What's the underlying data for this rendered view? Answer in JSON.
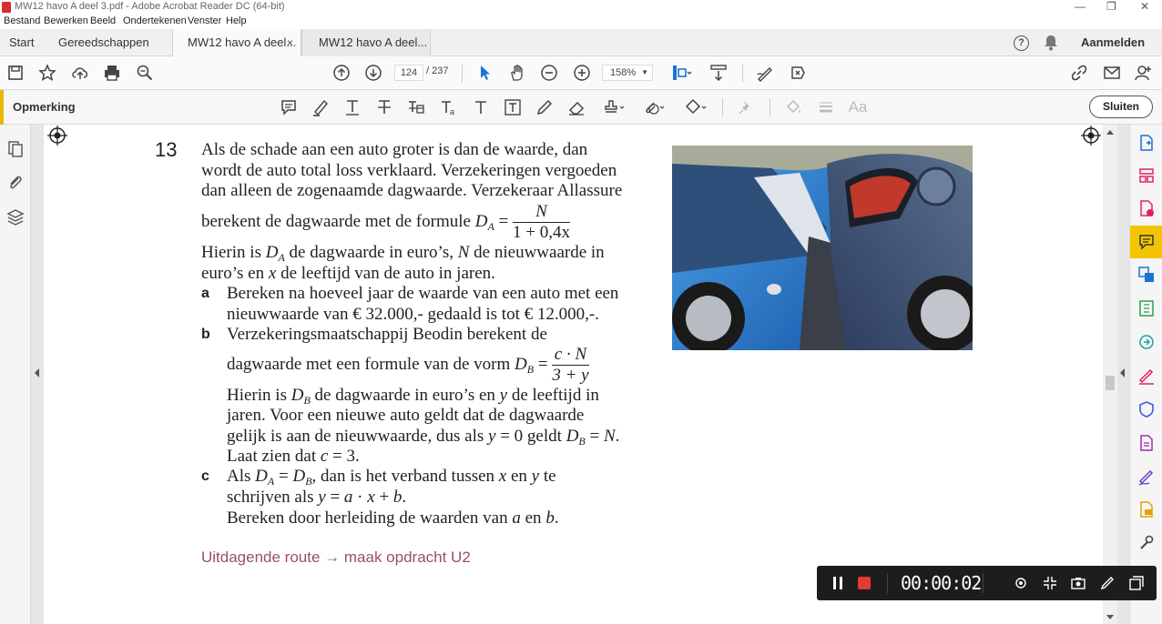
{
  "window": {
    "title": "MW12 havo A deel 3.pdf - Adobe Acrobat Reader DC (64-bit)",
    "minimize": "—",
    "maximize": "❐",
    "close": "✕"
  },
  "menu": [
    "Bestand",
    "Bewerken",
    "Beeld",
    "Ondertekenen",
    "Venster",
    "Help"
  ],
  "tabs": {
    "start": "Start",
    "tools": "Gereedschappen",
    "doc1": "MW12 havo A deel...",
    "doc2": "MW12 havo A deel...",
    "close_glyph": "×",
    "signin": "Aanmelden",
    "help_glyph": "?"
  },
  "toolbar": {
    "current_page": "124",
    "total_pages": "/ 237",
    "zoom": "158%"
  },
  "commentbar": {
    "label": "Opmerking",
    "close_label": "Sluiten"
  },
  "question": {
    "number": "13",
    "intro_lines": [
      "Als de schade aan een auto groter is dan de waarde, dan",
      "wordt de auto total loss verklaard. Verzekeringen vergoeden",
      "dan alleen de zogenaamde dagwaarde. Verzekeraar Allassure"
    ],
    "formula_line": "berekent de dagwaarde met de formule",
    "formula_a_num": "N",
    "formula_a_den": "1 + 0,4x",
    "def_line1_pre": "Hierin is",
    "def_line1_post": "de dagwaarde in euro’s,",
    "def_line1_end": "de nieuwwaarde in",
    "def_line2_pre": "euro’s en",
    "def_line2_post": "de leeftijd van de auto in jaren.",
    "a_letter": "a",
    "a_lines": [
      "Bereken na hoeveel jaar de waarde van een auto met een",
      "nieuwwaarde van € 32.000,- gedaald is tot € 12.000,-."
    ],
    "b_letter": "b",
    "b_line1": "Verzekeringsmaatschappij Beodin berekent de",
    "b_line2": "dagwaarde met een formule van de vorm",
    "formula_b_num": "c · N",
    "formula_b_den": "3 + y",
    "b_line3_pre": "Hierin is",
    "b_line3_post": "de dagwaarde in euro’s en",
    "b_line3_end": "de leeftijd in",
    "b_line4": "jaren. Voor een nieuwe auto geldt dat de dagwaarde",
    "b_line5_pre": "gelijk is aan de nieuwwaarde, dus als",
    "b_line5_mid": "= 0 geldt",
    "b_line5_end": "=",
    "b_line6_pre": "Laat zien dat",
    "b_line6_end": "= 3.",
    "c_letter": "c",
    "c_line1_pre": "Als",
    "c_line1_post": ", dan is het verband tussen",
    "c_line1_mid": "en",
    "c_line1_end": "te",
    "c_line2_pre": "schrijven als",
    "c_line3_pre": "Bereken door herleiding de waarden van",
    "c_line3_mid": "en",
    "route": "Uitdagende route → maak opdracht U2"
  },
  "recorder": {
    "time": "00:00:02"
  },
  "colors": {
    "accent": "#e6b800",
    "route": "#9b4f6e",
    "record": "#e53935"
  }
}
